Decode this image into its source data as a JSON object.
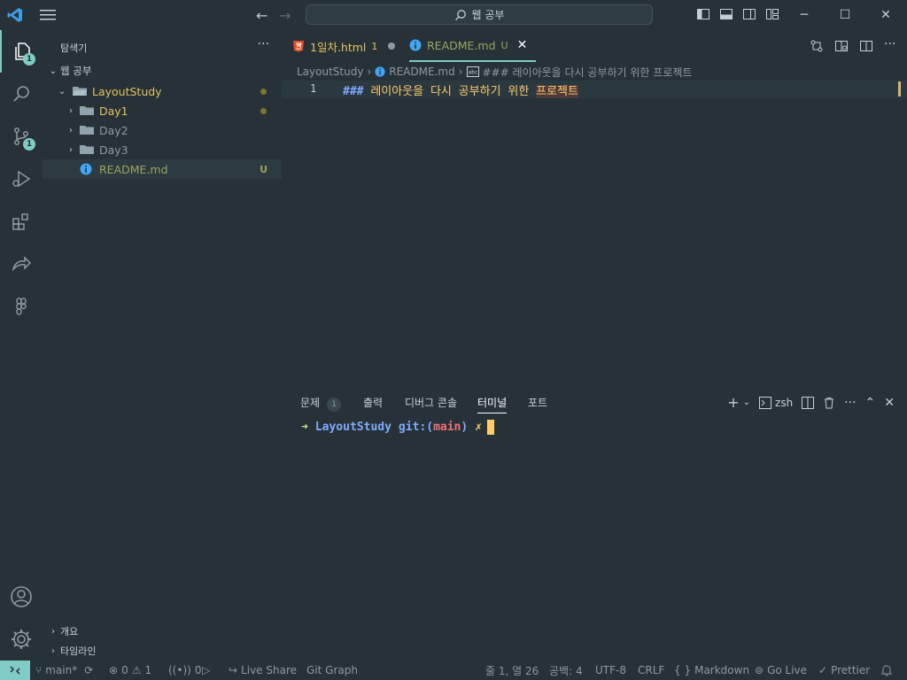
{
  "titlebar": {
    "search_text": "웹 공부",
    "minimize": "─",
    "maximize": "☐",
    "close": "✕"
  },
  "activity": {
    "explorer_badge": "1",
    "scm_badge": "1"
  },
  "sidebar": {
    "title": "탐색기",
    "more": "···",
    "workspace": "웹 공부",
    "root_folder": "LayoutStudy",
    "items": [
      {
        "label": "Day1",
        "color": "#e6c161"
      },
      {
        "label": "Day2",
        "color": "#8d9aa1"
      },
      {
        "label": "Day3",
        "color": "#8d9aa1"
      }
    ],
    "readme": "README.md",
    "readme_status": "U",
    "outline": "개요",
    "timeline": "타임라인"
  },
  "tabs": [
    {
      "label": "1일차.html",
      "count": "1"
    },
    {
      "label": "README.md",
      "status": "U"
    }
  ],
  "breadcrumbs": {
    "folder": "LayoutStudy",
    "file": "README.md",
    "symbol": "### 레이아웃을 다시 공부하기 위한 프로젝트"
  },
  "editor": {
    "line_number": "1",
    "heading_marker": "###",
    "heading_text": "레이아웃을 다시 공부하기 위한",
    "heading_highlight": "프로젝트"
  },
  "panel": {
    "tabs": [
      "문제",
      "출력",
      "디버그 콘솔",
      "터미널",
      "포트"
    ],
    "problems_count": "1",
    "shell": "zsh"
  },
  "terminal": {
    "arrow": "➜",
    "dir": "LayoutStudy",
    "git_prefix": "git:(",
    "branch": "main",
    "git_suffix": ")",
    "dirty": "✗"
  },
  "status": {
    "branch": "main*",
    "errors": "0",
    "warnings": "1",
    "ports": "0",
    "live_share": "Live Share",
    "git_graph": "Git Graph",
    "position": "줄 1, 열 26",
    "spaces": "공백: 4",
    "encoding": "UTF-8",
    "eol": "CRLF",
    "language": "Markdown",
    "go_live": "Go Live",
    "prettier": "Prettier"
  },
  "colors": {
    "background": "#263238",
    "accent": "#80cbc4",
    "terminal_green": "#c3e88d",
    "terminal_blue": "#82aaff",
    "terminal_red": "#f07178",
    "terminal_yellow": "#ffcb6b"
  }
}
